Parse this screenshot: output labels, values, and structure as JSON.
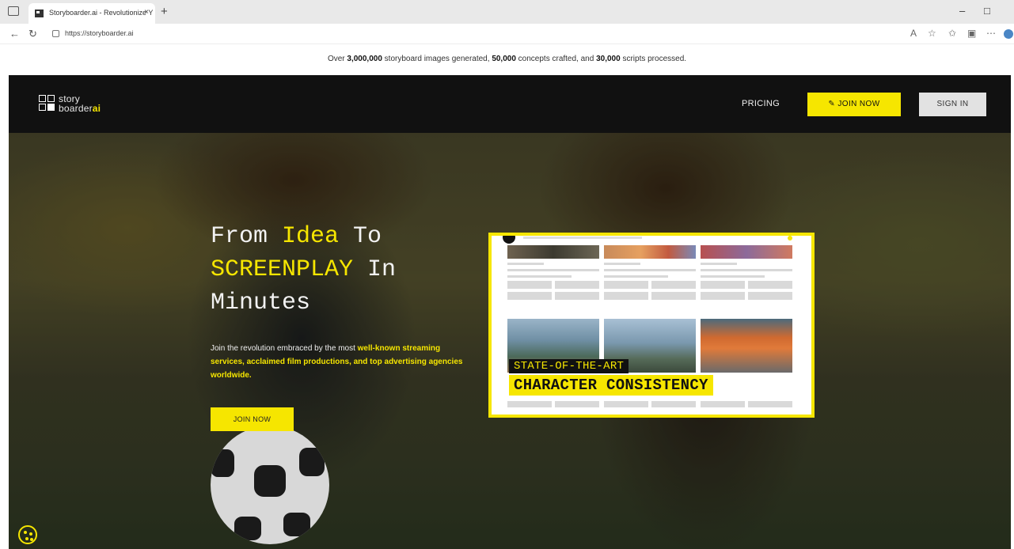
{
  "browser": {
    "tab_title": "Storyboarder.ai - Revolutionize Y",
    "tab_close": "×",
    "new_tab": "+",
    "url": "https://storyboarder.ai",
    "back": "←",
    "refresh": "↻",
    "minimize": "–",
    "restore": "□",
    "toolbar_icons": [
      "read-aloud-icon",
      "favorite-icon",
      "favorites-icon",
      "extensions-icon",
      "more-icon"
    ]
  },
  "announcement": {
    "prefix": "Over ",
    "images": "3,000,000",
    "mid1": " storyboard images generated, ",
    "concepts": "50,000",
    "mid2": " concepts crafted, and ",
    "scripts": "30,000",
    "suffix": " scripts processed."
  },
  "site_nav": {
    "logo_line1": "story",
    "logo_line2": "boarder",
    "logo_ai": "ai",
    "pricing": "PRICING",
    "join_now": "✎ JOIN NOW",
    "sign_in": "SIGN IN"
  },
  "hero": {
    "title_part1": "From ",
    "title_hl1": "Idea",
    "title_part2": " To",
    "title_hl2": "SCREENPLAY",
    "title_part3": " In",
    "title_part4": "Minutes",
    "sub_part1": "Join the revolution embraced by the most ",
    "sub_hl": "well-known streaming services, acclaimed film productions, and top advertising agencies worldwide.",
    "join_button": "JOIN NOW"
  },
  "preview": {
    "badge1": "STATE-OF-THE-ART",
    "badge2": "CHARACTER CONSISTENCY"
  },
  "colors": {
    "brand_yellow": "#f6e600",
    "dark_bg": "#111111"
  }
}
